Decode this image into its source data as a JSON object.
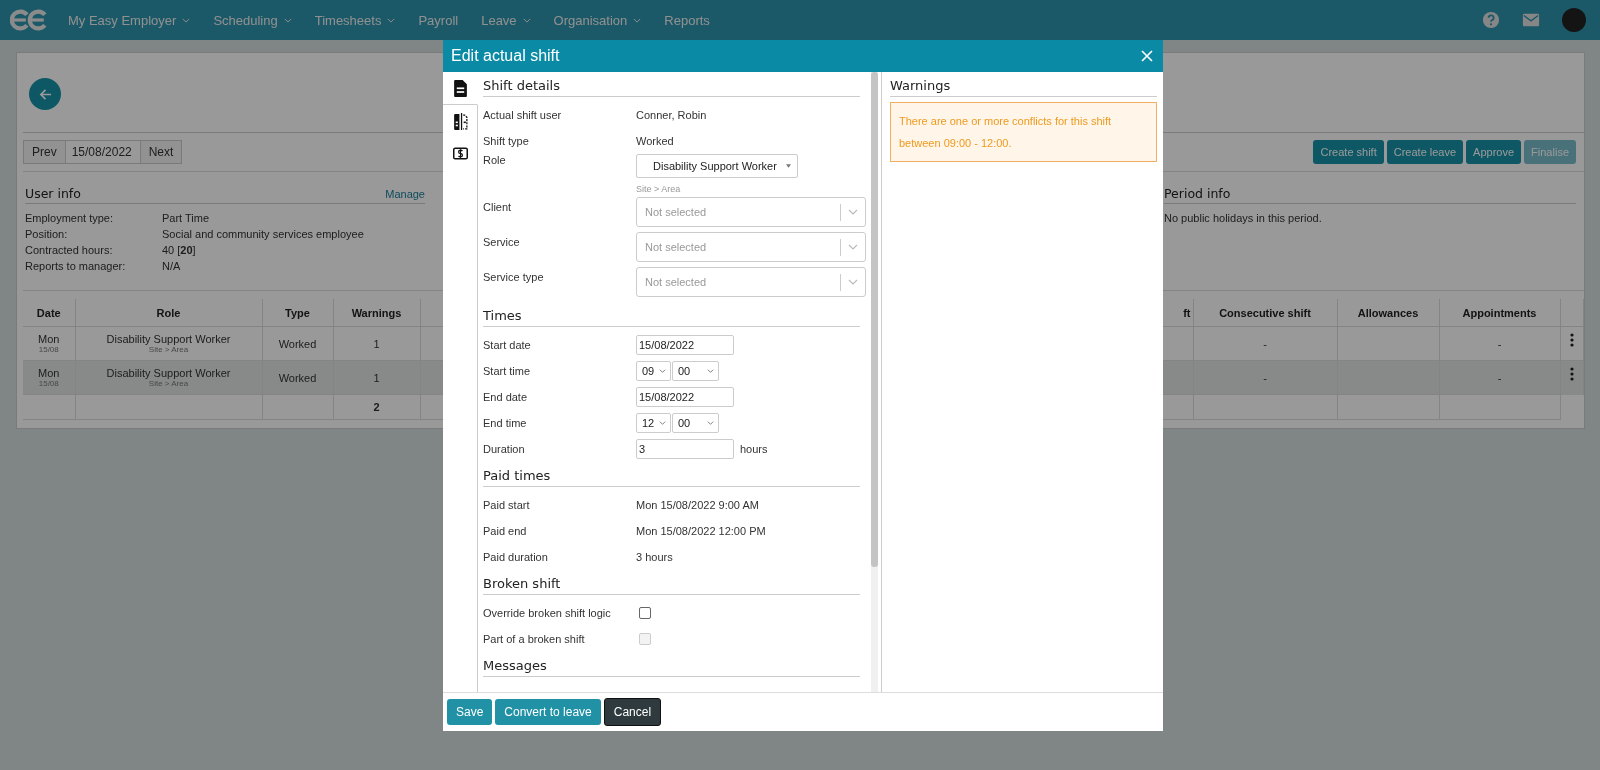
{
  "nav": {
    "items": [
      {
        "label": "My Easy Employer",
        "dropdown": true
      },
      {
        "label": "Scheduling",
        "dropdown": true
      },
      {
        "label": "Timesheets",
        "dropdown": true
      },
      {
        "label": "Payroll",
        "dropdown": false
      },
      {
        "label": "Leave",
        "dropdown": true
      },
      {
        "label": "Organisation",
        "dropdown": true
      },
      {
        "label": "Reports",
        "dropdown": false
      }
    ]
  },
  "page": {
    "date_nav": {
      "prev": "Prev",
      "date": "15/08/2022",
      "next": "Next"
    },
    "actions": [
      {
        "label": "Create shift",
        "disabled": false
      },
      {
        "label": "Create leave",
        "disabled": false
      },
      {
        "label": "Approve",
        "disabled": false
      },
      {
        "label": "Finalise",
        "disabled": true
      }
    ],
    "user_info": {
      "title": "User info",
      "link": "Manage",
      "fields": [
        {
          "label": "Employment type:",
          "value": "Part Time"
        },
        {
          "label": "Position:",
          "value": "Social and community services employee"
        },
        {
          "label": "Contracted hours:",
          "value": "40 [**20**]"
        },
        {
          "label": "Reports to manager:",
          "value": "N/A"
        }
      ]
    },
    "period_info": {
      "title": "Period info",
      "text": "No public holidays in this period."
    },
    "table": {
      "columns": [
        "Date",
        "Role",
        "Type",
        "Warnings",
        "ft",
        "Consecutive shift",
        "Allowances",
        "Appointments"
      ],
      "rows": [
        {
          "day": "Mon",
          "date": "15/08",
          "role": "Disability Support Worker",
          "location": "Site > Area",
          "type": "Worked",
          "warnings": "1",
          "consecutive_shift": "-",
          "appointments": "-",
          "selected": false
        },
        {
          "day": "Mon",
          "date": "15/08",
          "role": "Disability Support Worker",
          "location": "Site > Area",
          "type": "Worked",
          "warnings": "1",
          "consecutive_shift": "-",
          "appointments": "-",
          "selected": true
        }
      ],
      "totals": {
        "warnings": "2"
      }
    }
  },
  "modal": {
    "title": "Edit actual shift",
    "tabs": [
      {
        "kind": "details",
        "selected": true
      },
      {
        "kind": "compare",
        "selected": false
      },
      {
        "kind": "pay",
        "selected": false
      }
    ],
    "sections": [
      {
        "title": "Shift details",
        "fields": [
          {
            "kind": "text",
            "label": "Actual shift user",
            "value": "Conner, Robin"
          },
          {
            "kind": "text",
            "label": "Shift type",
            "value": "Worked"
          },
          {
            "kind": "select",
            "label": "Role",
            "value": "Disability Support Worker",
            "hint": "Site > Area"
          },
          {
            "kind": "combo",
            "label": "Client",
            "placeholder": "Not selected"
          },
          {
            "kind": "combo",
            "label": "Service",
            "placeholder": "Not selected"
          },
          {
            "kind": "combo",
            "label": "Service type",
            "placeholder": "Not selected"
          }
        ]
      },
      {
        "title": "Times",
        "fields": [
          {
            "kind": "input",
            "label": "Start date",
            "value": "15/08/2022"
          },
          {
            "kind": "time",
            "label": "Start time",
            "hour": "09",
            "minute": "00"
          },
          {
            "kind": "input",
            "label": "End date",
            "value": "15/08/2022"
          },
          {
            "kind": "time",
            "label": "End time",
            "hour": "12",
            "minute": "00"
          },
          {
            "kind": "input",
            "label": "Duration",
            "value": "3",
            "unit": "hours"
          }
        ]
      },
      {
        "title": "Paid times",
        "fields": [
          {
            "kind": "text",
            "label": "Paid start",
            "value": "Mon 15/08/2022 9:00 AM"
          },
          {
            "kind": "text",
            "label": "Paid end",
            "value": "Mon 15/08/2022 12:00 PM"
          },
          {
            "kind": "text",
            "label": "Paid duration",
            "value": "3 hours"
          }
        ]
      },
      {
        "title": "Broken shift",
        "fields": [
          {
            "kind": "checkbox",
            "label": "Override broken shift logic",
            "checked": false,
            "disabled": false
          },
          {
            "kind": "checkbox",
            "label": "Part of a broken shift",
            "checked": false,
            "disabled": true
          }
        ]
      },
      {
        "title": "Messages"
      }
    ],
    "warnings": {
      "title": "Warnings",
      "alerts": [
        "There are one or more conflicts for this shift between 09:00 - 12:00."
      ]
    },
    "buttons": [
      {
        "label": "Save",
        "kind": "primary"
      },
      {
        "label": "Convert to leave",
        "kind": "primary"
      },
      {
        "label": "Cancel",
        "kind": "dark"
      }
    ]
  }
}
